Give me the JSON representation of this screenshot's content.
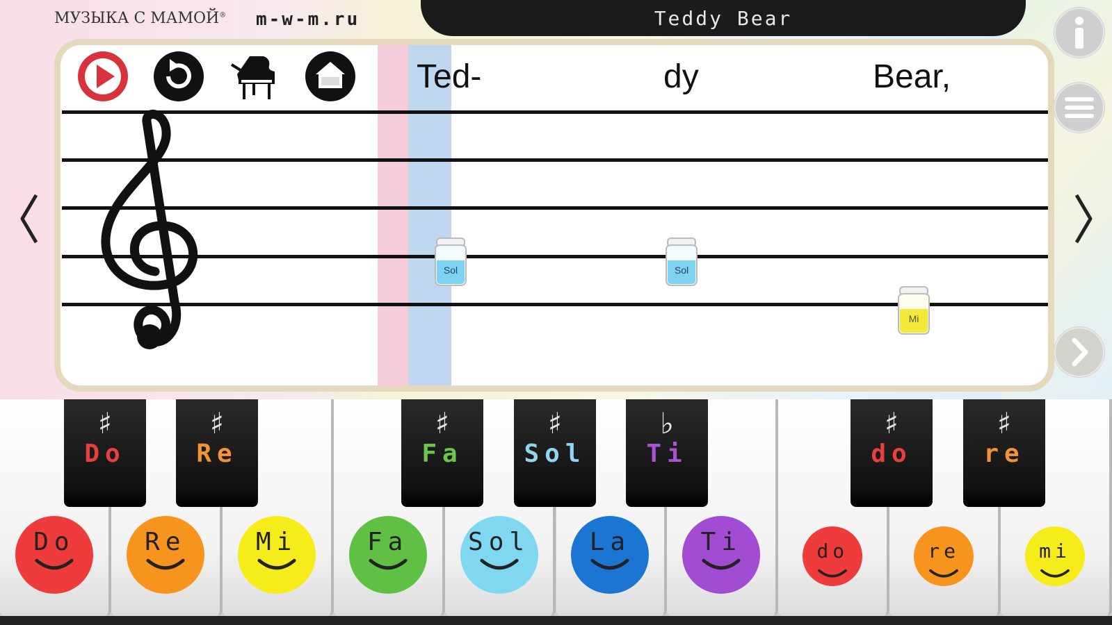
{
  "header": {
    "brand": "МУЗЫКА С МАМОЙ",
    "brand_mark": "®",
    "site": "m-w-m.ru",
    "song_title": "Teddy Bear"
  },
  "toolbar": {
    "play": "play-icon",
    "replay": "replay-icon",
    "piano": "grand-piano-icon",
    "home": "home-icon"
  },
  "side": {
    "info": "info-icon",
    "menu": "menu-icon",
    "next": "chevron-right-icon"
  },
  "lyrics": [
    "Ted-",
    "dy",
    "Bear,"
  ],
  "notes": [
    {
      "label": "Sol",
      "color": "#7fd2f2"
    },
    {
      "label": "Sol",
      "color": "#7fd2f2"
    },
    {
      "label": "Mi",
      "color": "#f5e83a"
    }
  ],
  "white_keys": [
    {
      "label": "Do",
      "color": "#ee3b3b"
    },
    {
      "label": "Re",
      "color": "#f7941d"
    },
    {
      "label": "Mi",
      "color": "#f7ec1b"
    },
    {
      "label": "Fa",
      "color": "#5fc043"
    },
    {
      "label": "Sol",
      "color": "#7fd8f0"
    },
    {
      "label": "La",
      "color": "#1a76d2"
    },
    {
      "label": "Ti",
      "color": "#a24bd3"
    },
    {
      "label": "do",
      "color": "#ee3b3b"
    },
    {
      "label": "re",
      "color": "#f7941d"
    },
    {
      "label": "mi",
      "color": "#f7ec1b"
    }
  ],
  "black_keys": [
    {
      "acc": "♯",
      "label": "Do",
      "color": "#e8403c"
    },
    {
      "acc": "♯",
      "label": "Re",
      "color": "#f29335"
    },
    {
      "acc": "♯",
      "label": "Fa",
      "color": "#6cc64b"
    },
    {
      "acc": "♯",
      "label": "Sol",
      "color": "#8fd6ee"
    },
    {
      "acc": "♭",
      "label": "Ti",
      "color": "#a952d6"
    },
    {
      "acc": "♯",
      "label": "do",
      "color": "#e8403c"
    },
    {
      "acc": "♯",
      "label": "re",
      "color": "#f29335"
    }
  ]
}
